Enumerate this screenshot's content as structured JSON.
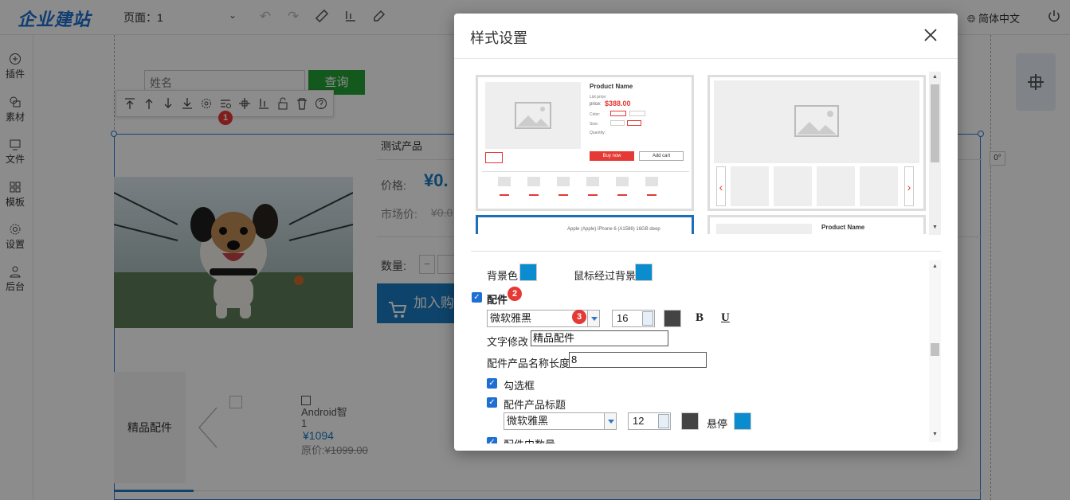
{
  "topbar": {
    "logo": "企业建站",
    "page_select": "页面：1",
    "language": "简体中文"
  },
  "sidebar": {
    "items": [
      {
        "label": "插件",
        "icon": "plus-circle-icon"
      },
      {
        "label": "素材",
        "icon": "material-icon"
      },
      {
        "label": "文件",
        "icon": "file-icon"
      },
      {
        "label": "模板",
        "icon": "template-icon"
      },
      {
        "label": "设置",
        "icon": "gear-icon"
      },
      {
        "label": "后台",
        "icon": "user-icon"
      }
    ]
  },
  "canvas": {
    "search_placeholder": "姓名",
    "search_button": "查询",
    "product": {
      "name": "测试产品",
      "price_label": "价格:",
      "price": "¥0.",
      "market_label": "市场价:",
      "market_price": "¥0.0",
      "qty_label": "数量:",
      "qty_minus": "−",
      "cart_button": "加入购"
    },
    "accessories": {
      "label": "精品配件",
      "item_name": "Android智\n1",
      "item_price": "¥1094",
      "orig_label": "原价:",
      "orig_price": "¥1099.00"
    },
    "rotate": "0°",
    "toolbar_badge": "1"
  },
  "dialog": {
    "title": "样式设置",
    "templates": [
      {
        "name": "Product Name",
        "list_price": "List price:",
        "price_label": "price:",
        "price": "$388.00",
        "color_label": "Color:",
        "size_label": "Size:",
        "qty_label": "Quantity:",
        "buy": "Buy now",
        "cart": "Add cart",
        "selected": false
      },
      {
        "selected": false
      },
      {
        "caption": "Apple (Apple) iPhone 6 (A1586) 16GB deep",
        "selected": true
      },
      {
        "name": "Product Name",
        "selected": false
      }
    ],
    "settings": {
      "bg_color_label": "背景色",
      "hover_bg_label": "鼠标经过背景",
      "accessory_label": "配件",
      "accessory_badge": "2",
      "font": "微软雅黑",
      "font_badge": "3",
      "font_size": "16",
      "bold": "B",
      "underline": "U",
      "text_edit_label": "文字修改",
      "text_edit_value": "精品配件",
      "name_len_label": "配件产品名称长度",
      "name_len_value": "8",
      "checkbox_label": "勾选框",
      "title_label": "配件产品标题",
      "title_font": "微软雅黑",
      "title_font_size": "12",
      "hover_label": "悬停",
      "qty_label": "配件中数量"
    },
    "colors": {
      "swatch_blue": "#0b8ccf",
      "swatch_dark": "#444444",
      "price_red": "#e53935",
      "accent": "#1b7dc4"
    }
  }
}
